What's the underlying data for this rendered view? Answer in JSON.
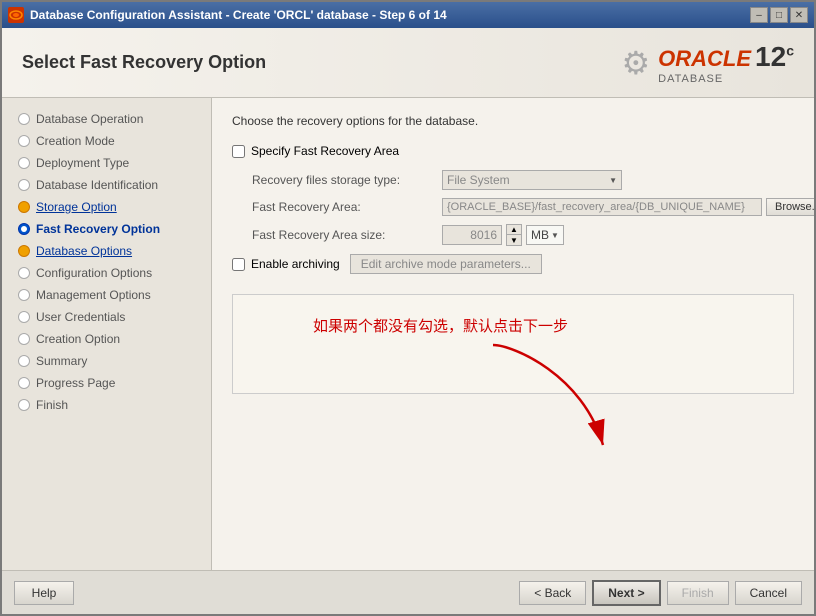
{
  "window": {
    "title": "Database Configuration Assistant - Create 'ORCL' database - Step 6 of 14",
    "icon": "db-icon"
  },
  "header": {
    "title": "Select Fast Recovery Option",
    "oracle_brand": "ORACLE",
    "oracle_sub": "DATABASE",
    "oracle_version": "12",
    "oracle_version_sup": "c"
  },
  "sidebar": {
    "items": [
      {
        "id": "database-operation",
        "label": "Database Operation",
        "state": "done"
      },
      {
        "id": "creation-mode",
        "label": "Creation Mode",
        "state": "done"
      },
      {
        "id": "deployment-type",
        "label": "Deployment Type",
        "state": "done"
      },
      {
        "id": "database-identification",
        "label": "Database Identification",
        "state": "done"
      },
      {
        "id": "storage-option",
        "label": "Storage Option",
        "state": "link"
      },
      {
        "id": "fast-recovery-option",
        "label": "Fast Recovery Option",
        "state": "active"
      },
      {
        "id": "database-options",
        "label": "Database Options",
        "state": "link"
      },
      {
        "id": "configuration-options",
        "label": "Configuration Options",
        "state": "normal"
      },
      {
        "id": "management-options",
        "label": "Management Options",
        "state": "normal"
      },
      {
        "id": "user-credentials",
        "label": "User Credentials",
        "state": "normal"
      },
      {
        "id": "creation-option",
        "label": "Creation Option",
        "state": "normal"
      },
      {
        "id": "summary",
        "label": "Summary",
        "state": "normal"
      },
      {
        "id": "progress-page",
        "label": "Progress Page",
        "state": "normal"
      },
      {
        "id": "finish",
        "label": "Finish",
        "state": "normal"
      }
    ]
  },
  "content": {
    "instruction": "Choose the recovery options for the database.",
    "specify_fra_label": "Specify Fast Recovery Area",
    "recovery_files_label": "Recovery files storage type:",
    "recovery_files_value": "File System",
    "fast_recovery_area_label": "Fast Recovery Area:",
    "fast_recovery_area_value": "{ORACLE_BASE}/fast_recovery_area/{DB_UNIQUE_NAME}",
    "browse_label": "Browse...",
    "fast_recovery_size_label": "Fast Recovery Area size:",
    "fast_recovery_size_value": "8016",
    "size_unit": "MB",
    "enable_archiving_label": "Enable archiving",
    "edit_archive_btn": "Edit archive mode parameters...",
    "annotation_text": "如果两个都没有勾选，默认点击下一步"
  },
  "buttons": {
    "help": "Help",
    "back": "< Back",
    "next": "Next >",
    "finish": "Finish",
    "cancel": "Cancel"
  }
}
